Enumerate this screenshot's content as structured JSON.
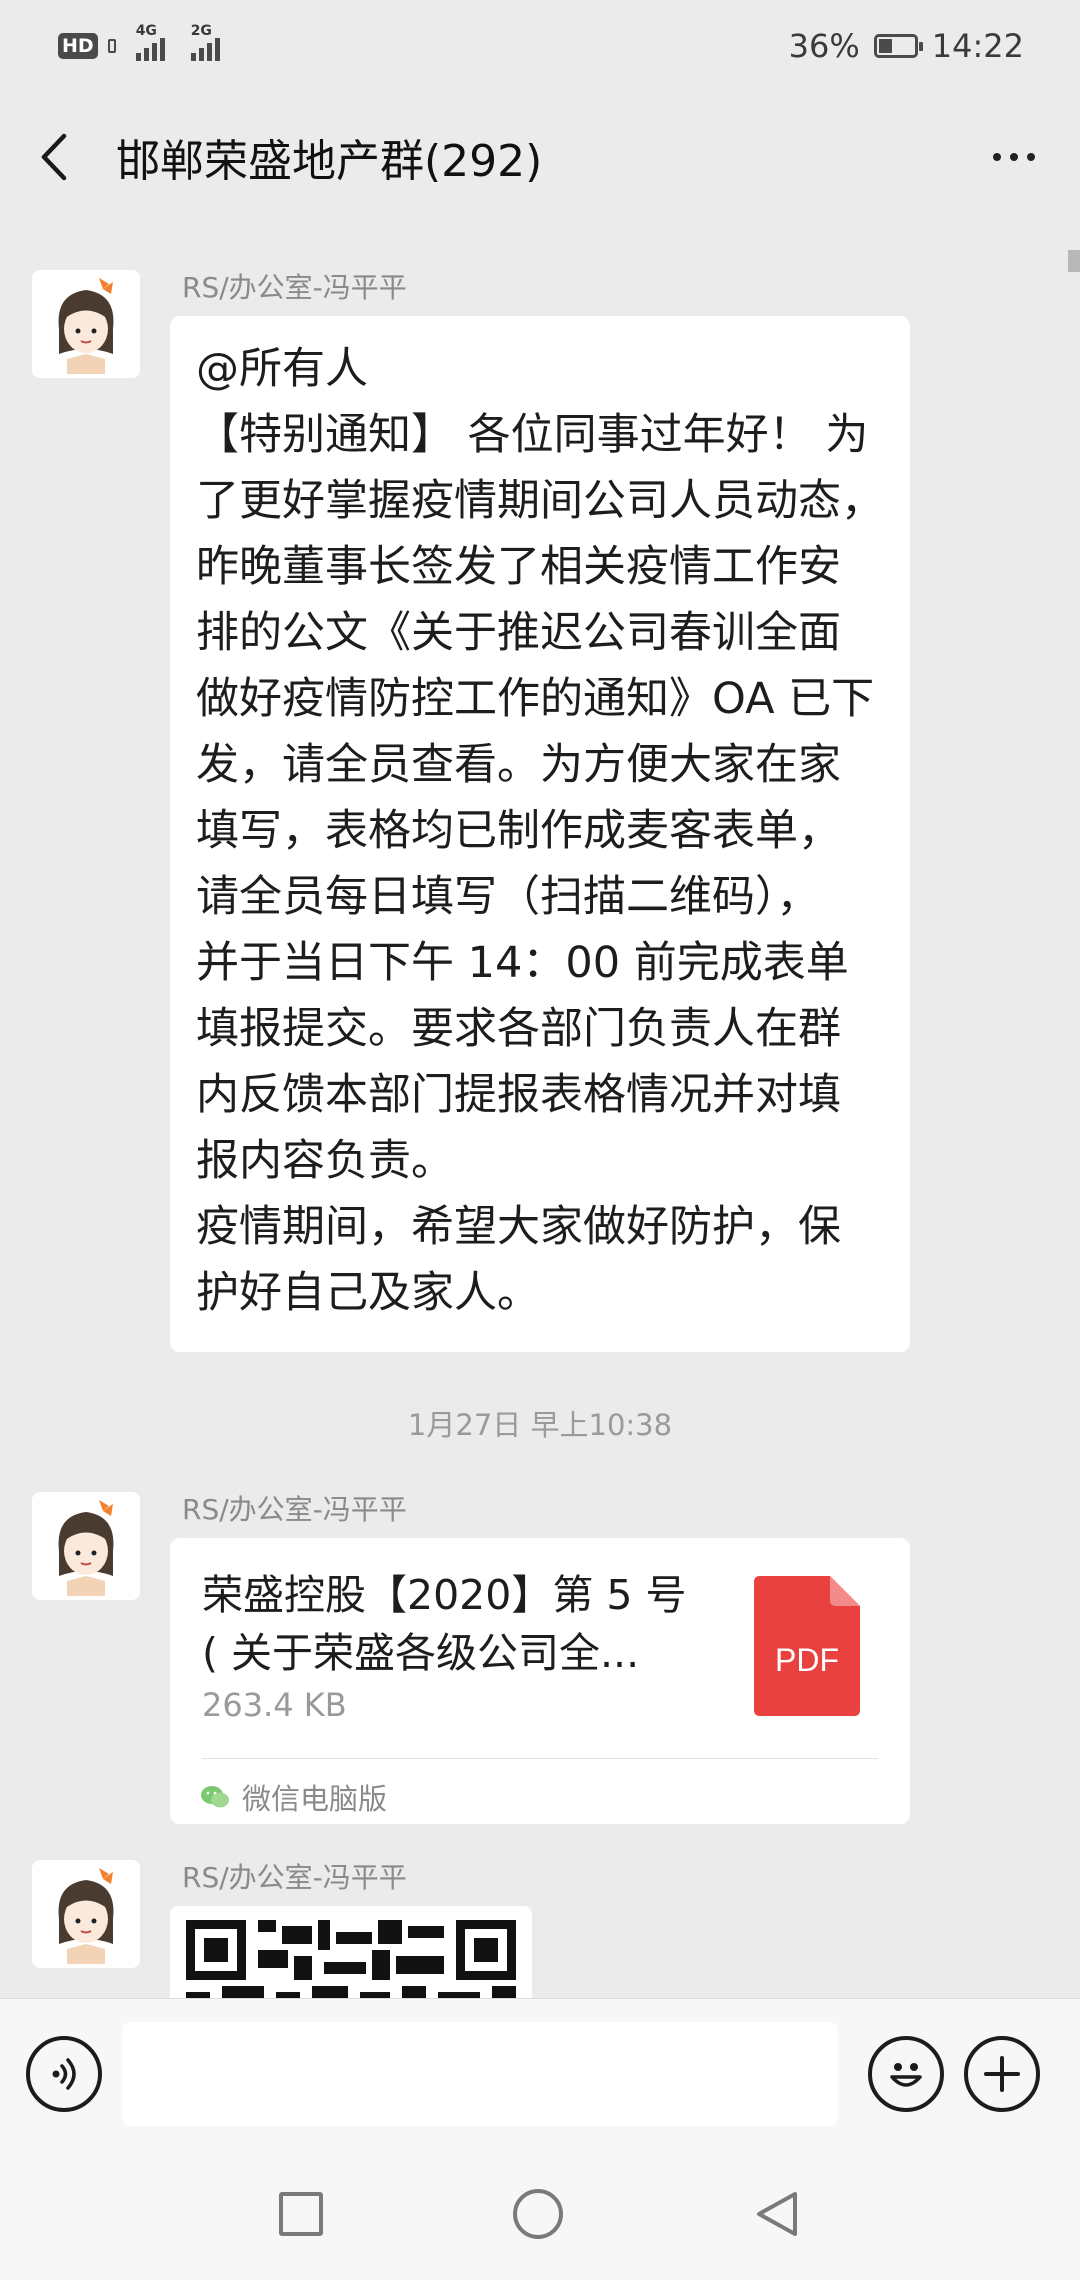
{
  "status_bar": {
    "hd": "HD",
    "net1": "4G",
    "net2": "2G",
    "battery": "36%",
    "time": "14:22"
  },
  "header": {
    "title": "邯郸荣盛地产群(292)"
  },
  "messages": [
    {
      "sender": "RS/办公室-冯平平",
      "type": "text",
      "lines": [
        "@所有人",
        "【特别通知】 各位同事过年好！ 为",
        "了更好掌握疫情期间公司人员动态，",
        "昨晚董事长签发了相关疫情工作安",
        "排的公文《关于推迟公司春训全面",
        "做好疫情防控工作的通知》OA 已下",
        "发，请全员查看。为方便大家在家",
        "填写，表格均已制作成麦客表单，",
        "请全员每日填写（扫描二维码），",
        "并于当日下午 14：00 前完成表单",
        "填报提交。要求各部门负责人在群",
        "内反馈本部门提报表格情况并对填",
        "报内容负责。",
        "疫情期间，希望大家做好防护，保",
        "护好自己及家人。"
      ]
    },
    {
      "sender": "RS/办公室-冯平平",
      "type": "file",
      "file_name_line1": "荣盛控股【2020】第 5 号",
      "file_name_line2": "( 关于荣盛各级公司全...",
      "file_size": "263.4 KB",
      "file_label": "PDF",
      "source": "微信电脑版"
    },
    {
      "sender": "RS/办公室-冯平平",
      "type": "image"
    }
  ],
  "timestamp": "1月27日 早上10:38",
  "input": {
    "value": ""
  },
  "colors": {
    "background": "#ebebeb",
    "bubble": "#ffffff",
    "pdf_red": "#e94140",
    "wechat_green": "#07c160"
  },
  "icons": [
    "voice-icon",
    "emoji-icon",
    "plus-icon",
    "back-icon",
    "more-icon",
    "pdf-icon",
    "wechat-icon"
  ]
}
